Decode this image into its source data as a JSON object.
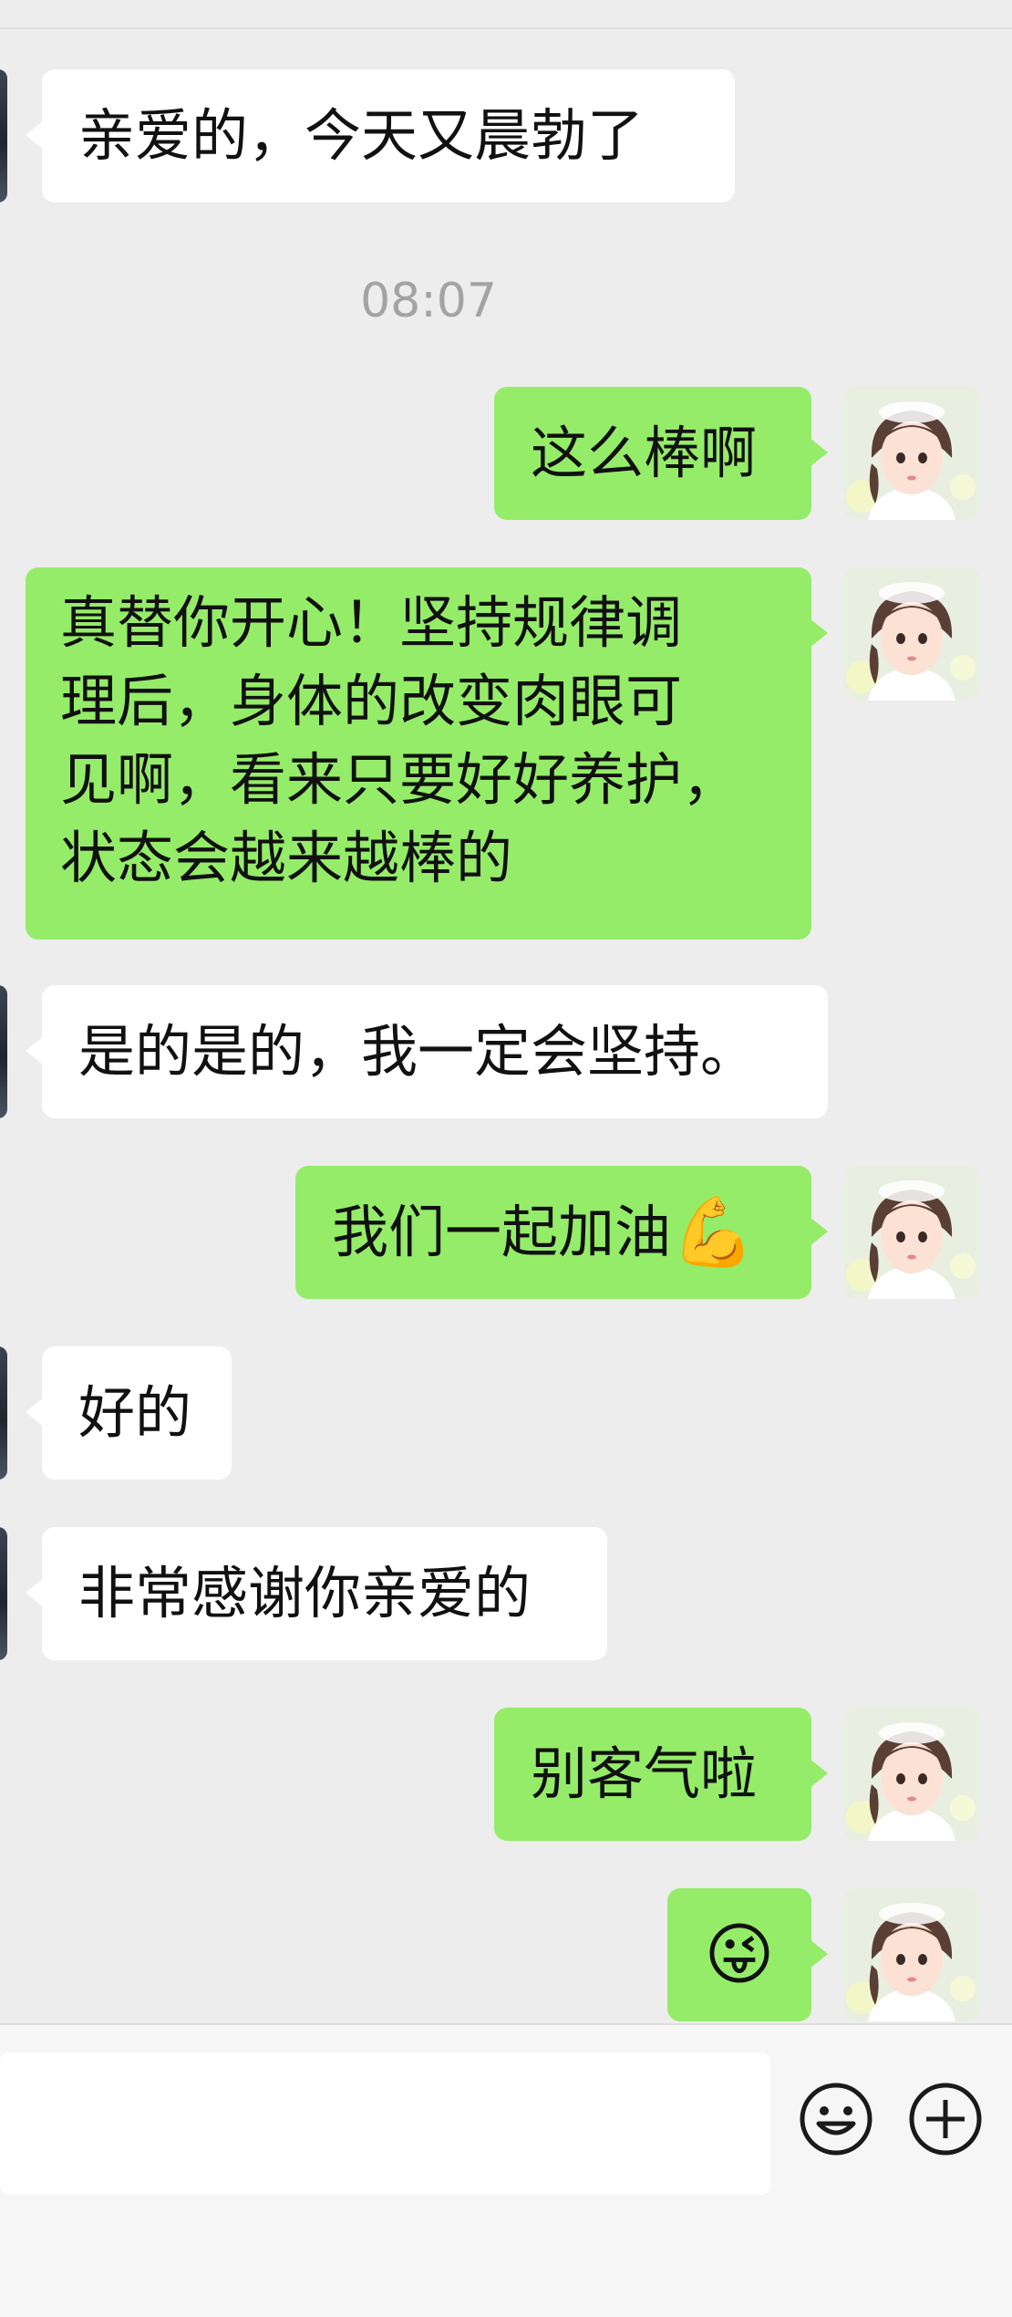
{
  "conversation": {
    "timestamp": "08:07",
    "messages": [
      {
        "side": "in",
        "text": "亲爱的，今天又晨勃了"
      },
      {
        "side": "out",
        "text": "这么棒啊"
      },
      {
        "side": "out",
        "lines": [
          "真替你开心！坚持规律调",
          "理后，身体的改变肉眼可",
          "见啊，看来只要好好养护，",
          "状态会越来越棒的"
        ]
      },
      {
        "side": "in",
        "text": "是的是的，我一定会坚持。"
      },
      {
        "side": "out",
        "text": "我们一起加油",
        "emoji": "💪"
      },
      {
        "side": "in",
        "text": "好的"
      },
      {
        "side": "in",
        "text": "非常感谢你亲爱的"
      },
      {
        "side": "out",
        "text": "别客气啦"
      },
      {
        "side": "out",
        "emoji": "😜"
      }
    ]
  },
  "input_bar": {
    "emoji_button_icon": "smiley-face-icon",
    "more_button_icon": "plus-circle-icon"
  },
  "colors": {
    "background": "#ededed",
    "outgoing_bubble": "#95ec69",
    "incoming_bubble": "#ffffff",
    "timestamp": "#a3a3a3"
  }
}
